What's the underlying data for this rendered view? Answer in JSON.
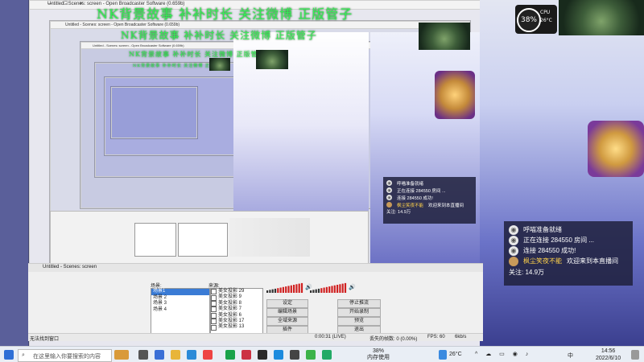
{
  "window": {
    "title": "Untitled - Scenes: screen - Open Broadcaster Software (0.659b)",
    "controls": "— ☐ ✕"
  },
  "banner": "NK背景故事 补补时长   关注微博 正版管子",
  "hud": {
    "percent": "38%",
    "cpu_label": "CPU",
    "cpu_value": "26°C"
  },
  "chat": {
    "messages": [
      {
        "icon": "info-icon",
        "text": "呼喵准备就绪",
        "highlight": ""
      },
      {
        "icon": "info-icon",
        "text": "正在连接 284550 房间 ...",
        "highlight": ""
      },
      {
        "icon": "info-icon",
        "text": "连接 284550 成功!",
        "highlight": ""
      },
      {
        "icon": "avatar",
        "text": "欢迎来到本直播间",
        "highlight": "枫尘笑夜不能"
      }
    ],
    "followers": "关注: 14.9万"
  },
  "obs": {
    "window_title": "Untitled - Scenes: screen",
    "scenes_label": "场景:",
    "sources_label": "来源:",
    "scenes": [
      "场景1",
      "场景 2",
      "场景 3",
      "场景 4"
    ],
    "sources": [
      "美女投影 29",
      "美女投影 9",
      "美女投影 8",
      "美女投影 7",
      "美女投影 6",
      "美女投影 17",
      "美女投影 13",
      "美女投影 12",
      "美女投影 26",
      "美女投影 10"
    ],
    "buttons": {
      "settings": "设定",
      "edit_scene": "编辑场景",
      "global_sources": "全域来源",
      "plugins": "插件",
      "stop_stream": "停止推流",
      "start_recording": "开始录制",
      "preview": "预览",
      "exit": "退出"
    },
    "status": {
      "left": "无法找到窗口",
      "time": "0:00:31 (LIVE)",
      "dropped": "丢失的帧数: 0 (0.00%)",
      "fps": "FPS: 60",
      "bitrate": "6kb/s"
    }
  },
  "taskbar": {
    "search_placeholder": "在这里输入你要搜索的内容",
    "weather": "26°C",
    "clock_time": "14:56",
    "clock_date": "2022/6/10",
    "battery": "38%",
    "memory": "内存使用",
    "ime": "中"
  }
}
